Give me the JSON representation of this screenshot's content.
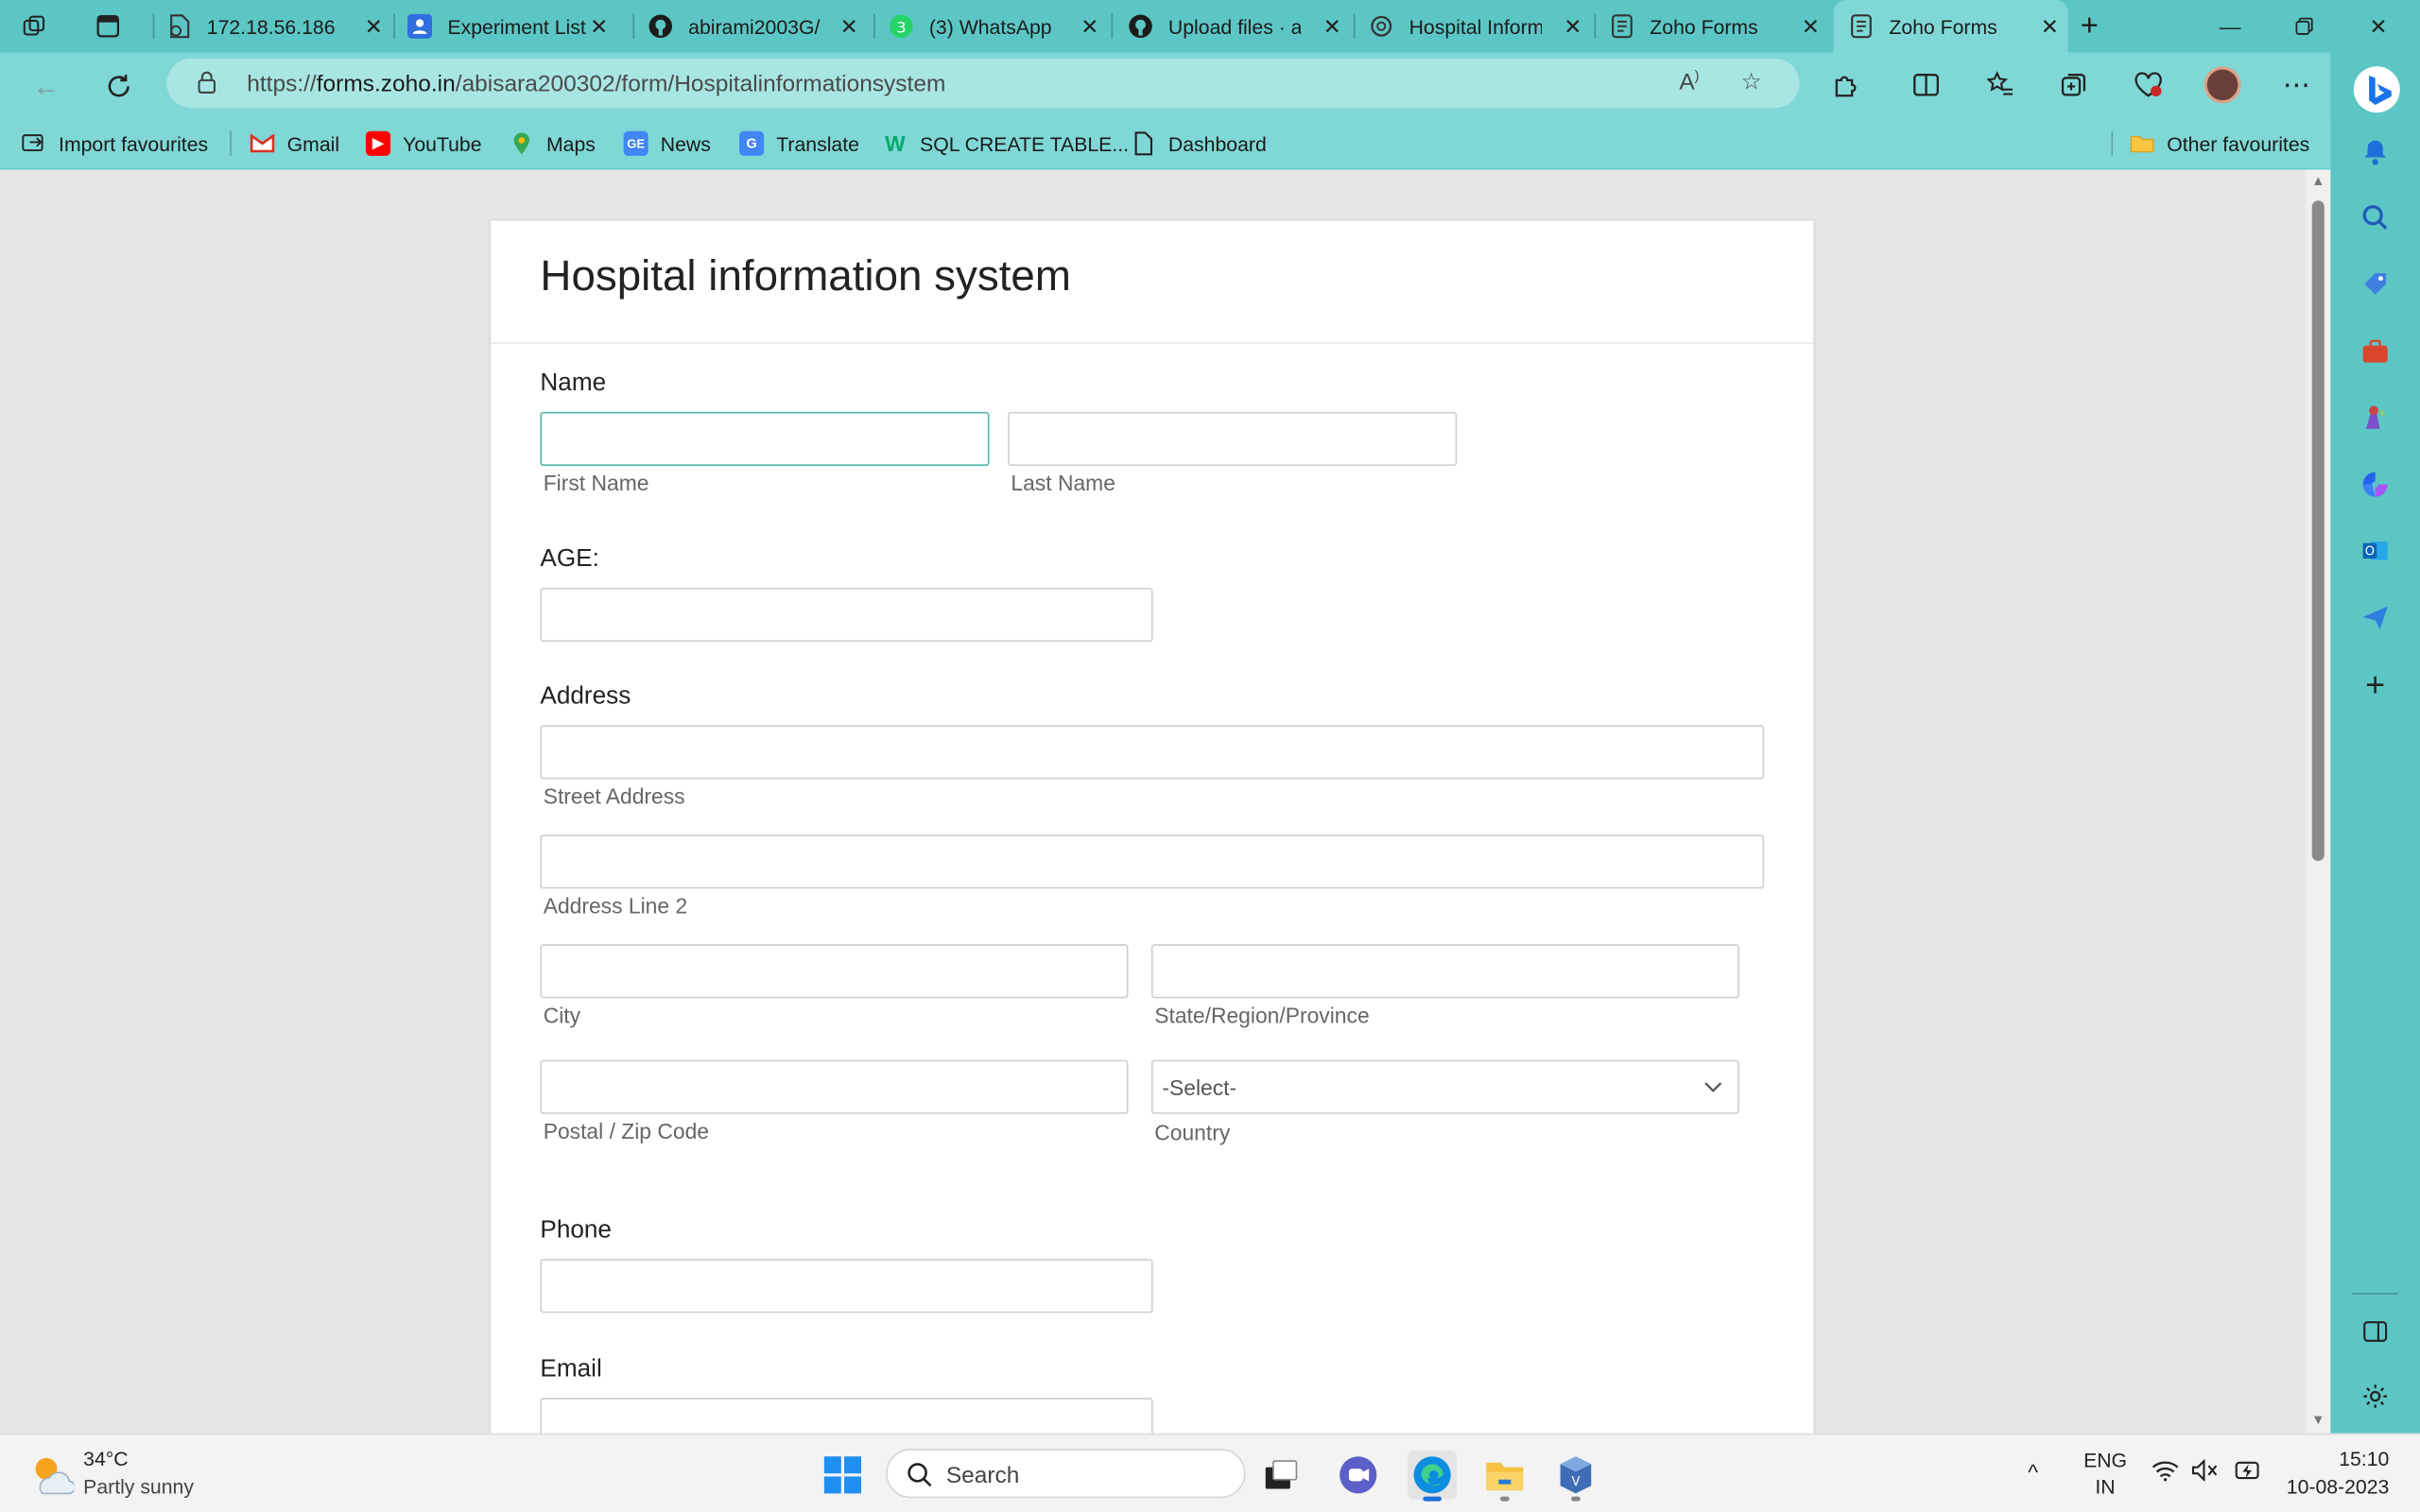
{
  "browser": {
    "tabs": [
      {
        "title": "172.18.56.186",
        "icon": "document-icon"
      },
      {
        "title": "Experiment List",
        "icon": "people-icon"
      },
      {
        "title": "abirami2003G/",
        "icon": "github-icon"
      },
      {
        "title": "(3) WhatsApp",
        "icon": "whatsapp-icon"
      },
      {
        "title": "Upload files · al",
        "icon": "github-icon"
      },
      {
        "title": "Hospital Inform",
        "icon": "openai-icon"
      },
      {
        "title": "Zoho Forms",
        "icon": "form-icon"
      },
      {
        "title": "Zoho Forms",
        "icon": "form-icon",
        "active": true
      }
    ],
    "url_prefix": "https://",
    "url_domain": "forms.zoho.in",
    "url_path": "/abisara200302/form/Hospitalinformationsystem",
    "bookmarks": [
      {
        "label": "Import favourites",
        "icon": "import-icon"
      },
      {
        "label": "Gmail",
        "icon": "gmail-icon"
      },
      {
        "label": "YouTube",
        "icon": "youtube-icon"
      },
      {
        "label": "Maps",
        "icon": "maps-icon"
      },
      {
        "label": "News",
        "icon": "news-icon"
      },
      {
        "label": "Translate",
        "icon": "translate-icon"
      },
      {
        "label": "SQL CREATE TABLE...",
        "icon": "w3schools-icon"
      },
      {
        "label": "Dashboard",
        "icon": "page-icon"
      }
    ],
    "other_favourites": "Other favourites",
    "theme_color": "#5cc6c4"
  },
  "form": {
    "title": "Hospital information system",
    "name_label": "Name",
    "first_name_caption": "First Name",
    "last_name_caption": "Last Name",
    "age_label": "AGE:",
    "address_label": "Address",
    "street_caption": "Street Address",
    "line2_caption": "Address Line 2",
    "city_caption": "City",
    "state_caption": "State/Region/Province",
    "zip_caption": "Postal / Zip Code",
    "country_caption": "Country",
    "country_selected": "-Select-",
    "phone_label": "Phone",
    "email_label": "Email"
  },
  "taskbar": {
    "weather_temp": "34°C",
    "weather_desc": "Partly sunny",
    "search_placeholder": "Search",
    "lang_line1": "ENG",
    "lang_line2": "IN",
    "time": "15:10",
    "date": "10-08-2023"
  }
}
